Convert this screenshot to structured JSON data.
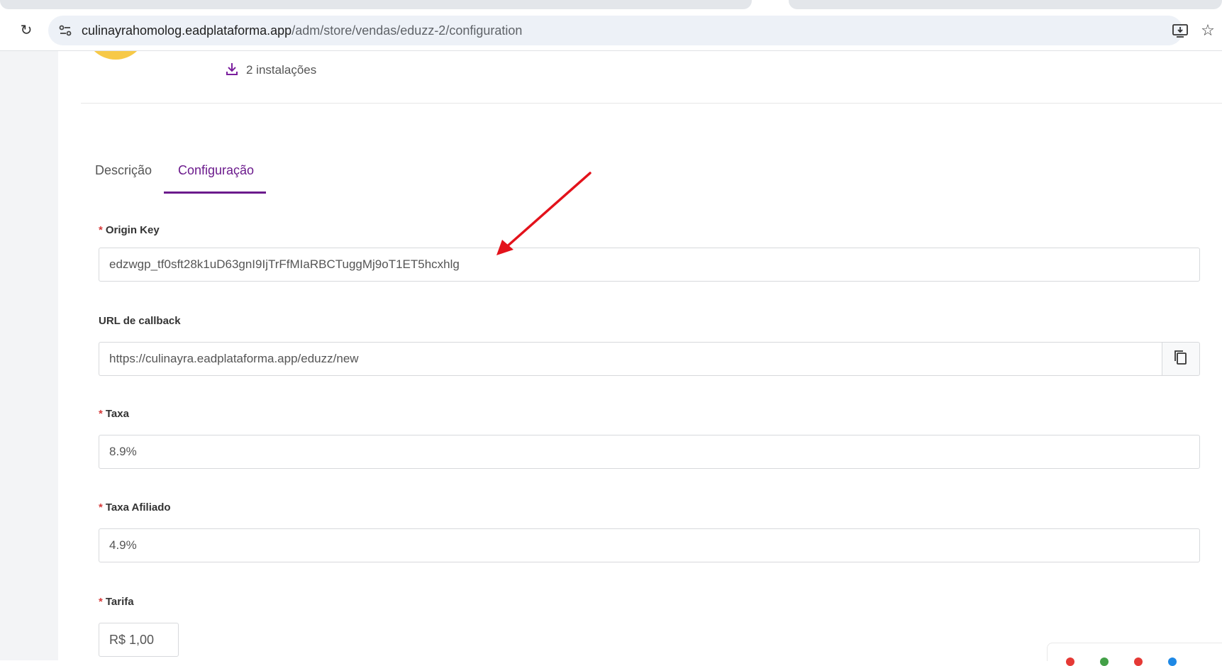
{
  "browser": {
    "url_host": "culinayrahomolog.eadplataforma.app",
    "url_path": "/adm/store/vendas/eduzz-2/configuration"
  },
  "app": {
    "installs_label": "2 instalações"
  },
  "tabs": [
    {
      "label": "Descrição",
      "active": false
    },
    {
      "label": "Configuração",
      "active": true
    }
  ],
  "form": {
    "origin_key": {
      "label": "Origin Key",
      "required": true,
      "value": "edzwgp_tf0sft28k1uD63gnI9IjTrFfMIaRBCTuggMj9oT1ET5hcxhlg"
    },
    "callback_url": {
      "label": "URL de callback",
      "required": false,
      "value": "https://culinayra.eadplataforma.app/eduzz/new"
    },
    "taxa": {
      "label": "Taxa",
      "required": true,
      "value": "8.9%"
    },
    "taxa_afiliado": {
      "label": "Taxa Afiliado",
      "required": true,
      "value": "4.9%"
    },
    "tarifa": {
      "label": "Tarifa",
      "required": true,
      "value": "R$ 1,00"
    }
  },
  "required_mark": "*",
  "colors": {
    "accent": "#6b1a8c",
    "required": "#d63b3b",
    "annotation_arrow": "#e3121b",
    "logo": "#f7c948"
  }
}
